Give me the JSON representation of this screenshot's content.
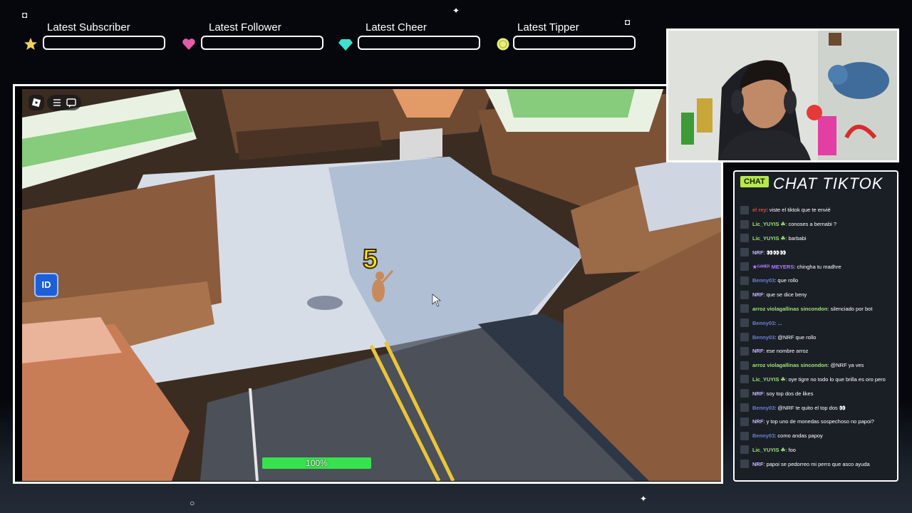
{
  "top_alerts": [
    {
      "label": "Latest Subscriber",
      "icon": "star-icon",
      "color": "#f2d15a"
    },
    {
      "label": "Latest Follower",
      "icon": "heart-icon",
      "color": "#e45ca9"
    },
    {
      "label": "Latest Cheer",
      "icon": "gem-icon",
      "color": "#3fe0d0"
    },
    {
      "label": "Latest Tipper",
      "icon": "coin-icon",
      "color": "#e8f07a"
    }
  ],
  "game": {
    "countdown": "5",
    "progress_label": "100%",
    "progress_value": 1.0,
    "id_button": "ID",
    "toolbar_icons": [
      "roblox-logo-icon",
      "menu-icon",
      "chat-bubble-icon"
    ]
  },
  "chat": {
    "badge": "CHAT",
    "title": "CHAT TIKTOK",
    "messages": [
      {
        "user": "el rey",
        "text": ": viste el tiktok que te envié",
        "color": "#e0493a"
      },
      {
        "user": "Lic_YUYIS ☘",
        "text": ": conoses a bernabi ?",
        "color": "#9fe07a"
      },
      {
        "user": "Lic_YUYIS ☘",
        "text": ": barbabi",
        "color": "#9fe07a"
      },
      {
        "user": "NRF",
        "text": ": 👀👀👀",
        "color": "#c9b7ff"
      },
      {
        "user": "★ᴳᴬᴹᴱᴿ MEYERS",
        "text": ": chingha tu madhre",
        "color": "#b27bff"
      },
      {
        "user": "Benny03",
        "text": ": que rollo",
        "color": "#6b7fd8"
      },
      {
        "user": "NRF",
        "text": ": que se dice beny",
        "color": "#c9b7ff"
      },
      {
        "user": "arroz violagallinas sincondon",
        "text": ": silenciado por bot",
        "color": "#9fe07a"
      },
      {
        "user": "Benny03",
        "text": ": ...",
        "color": "#6b7fd8"
      },
      {
        "user": "Benny03",
        "text": ": @NRF que rollo",
        "color": "#6b7fd8"
      },
      {
        "user": "NRF",
        "text": ": ese nombre arroz",
        "color": "#c9b7ff"
      },
      {
        "user": "arroz violagallinas sincondon",
        "text": ": @NRF ya ves",
        "color": "#9fe07a"
      },
      {
        "user": "Lic_YUYIS ☘",
        "text": ": oye tigre no todo lo que brilla es oro pero",
        "color": "#9fe07a"
      },
      {
        "user": "NRF",
        "text": ": soy top dos de likes",
        "color": "#c9b7ff"
      },
      {
        "user": "Benny03",
        "text": ": @NRF te quito el top dos 👀",
        "color": "#6b7fd8"
      },
      {
        "user": "NRF",
        "text": ": y top uno de monedas sospechoso no papoi?",
        "color": "#c9b7ff"
      },
      {
        "user": "Benny03",
        "text": ": como andas papoy",
        "color": "#6b7fd8"
      },
      {
        "user": "Lic_YUYIS ☘",
        "text": ": foo",
        "color": "#9fe07a"
      },
      {
        "user": "NRF",
        "text": ": papoi se pedorreo mi perro que asco ayuda",
        "color": "#c9b7ff"
      }
    ]
  }
}
